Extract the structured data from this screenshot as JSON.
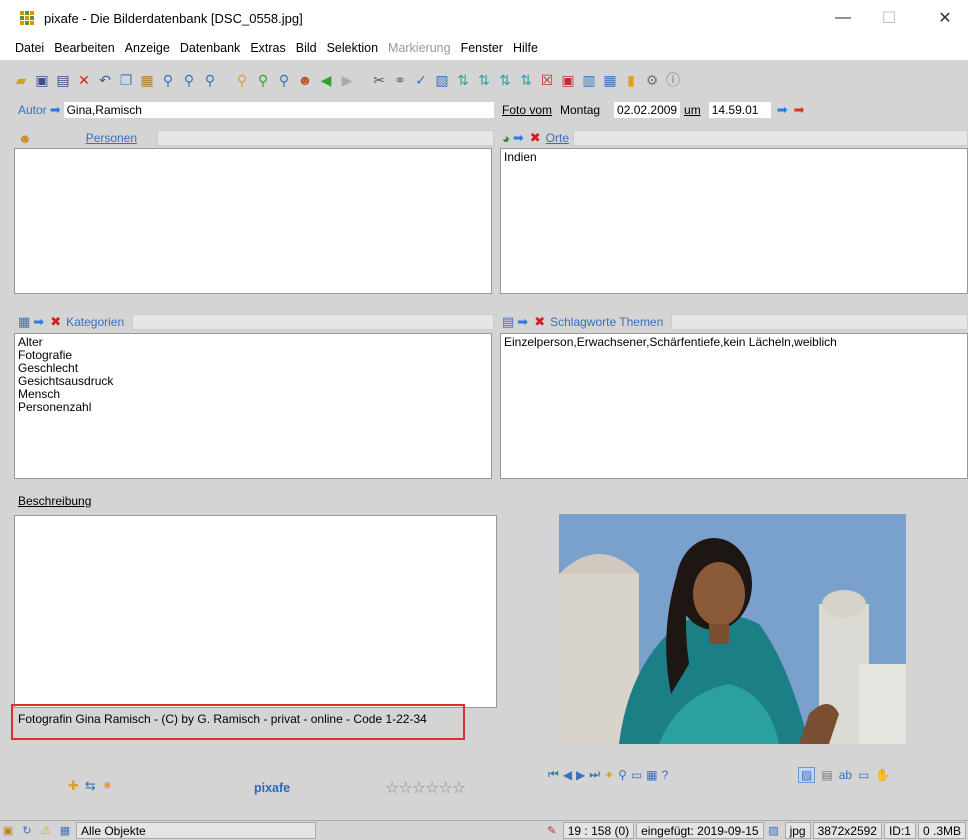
{
  "window": {
    "title": "pixafe - Die Bilderdatenbank  [DSC_0558.jpg]",
    "minimize": "—",
    "maximize": "☐",
    "close": "✕"
  },
  "menu": [
    "Datei",
    "Bearbeiten",
    "Anzeige",
    "Datenbank",
    "Extras",
    "Bild",
    "Selektion",
    "Markierung",
    "Fenster",
    "Hilfe"
  ],
  "menu_disabled": [
    "Markierung"
  ],
  "author": {
    "label": "Autor",
    "value": "Gina,Ramisch"
  },
  "date": {
    "label": "Foto vom",
    "weekday": "Montag",
    "value": "02.02.2009",
    "um_label": "um",
    "time": "14.59.01"
  },
  "persons": {
    "label": "Personen",
    "items": []
  },
  "places": {
    "label": "Orte",
    "items": [
      "Indien"
    ]
  },
  "categories": {
    "label": "Kategorien",
    "items": [
      "Alter",
      "Fotografie",
      "Geschlecht",
      "Gesichtsausdruck",
      "Mensch",
      "Personenzahl"
    ]
  },
  "keywords": {
    "label": "Schlagworte Themen",
    "value": "Einzelperson,Erwachsener,Schärfentiefe,kein Lächeln,weiblich"
  },
  "description": {
    "label": "Beschreibung",
    "value": ""
  },
  "copyright": "Fotografin Gina Ramisch - (C) by G. Ramisch - privat - online - Code 1-22-34",
  "footer": {
    "brand": "pixafe",
    "rating_stars": "☆☆☆☆☆☆"
  },
  "status": {
    "filter": "Alle Objekte",
    "position": "19 : 158 (0)",
    "inserted": "eingefügt: 2019-09-15",
    "format": "jpg",
    "dimensions": "3872x2592",
    "id": "ID:1",
    "size": "0 .3MB"
  }
}
